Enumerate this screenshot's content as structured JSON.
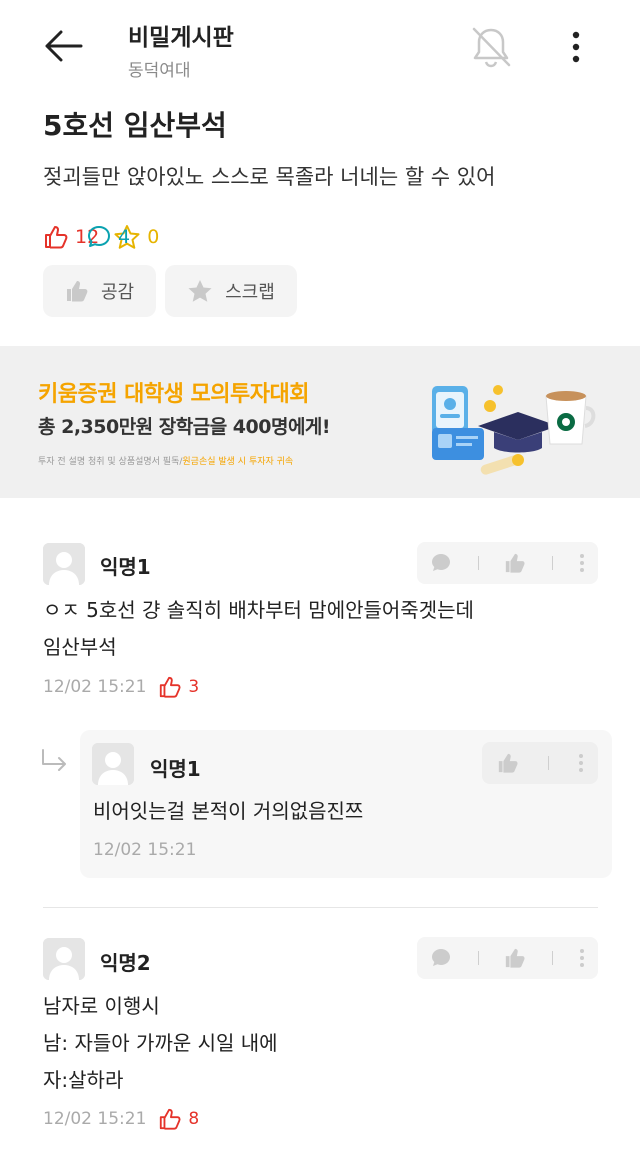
{
  "header": {
    "board_title": "비밀게시판",
    "board_subtitle": "동덕여대",
    "icons": [
      "back-arrow-icon",
      "bell-off-icon",
      "more-vertical-icon"
    ]
  },
  "post": {
    "title": "5호선 임산부석",
    "body": "젖괴들만 앉아있노 스스로 목졸라 너네는 할 수 있어",
    "likes": "12",
    "comments": "4",
    "scraps": "0",
    "like_button": "공감",
    "scrap_button": "스크랩"
  },
  "ad": {
    "title": "키움증권 대학생 모의투자대회",
    "subtitle": "총 2,350만원 장학금을 400명에게!",
    "disclaimer_a": "투자 전 설명 청취 및 상품설명서 필독/",
    "disclaimer_b": "원금손실 발생 시 투자자 귀속"
  },
  "comments": [
    {
      "nick": "익명1",
      "line1": "ㅇㅈ 5호선 걍 솔직히 배차부터 맘에안들어죽겟는데",
      "line2": "임산부석",
      "time": "12/02 15:21",
      "likes": "3",
      "reply": {
        "nick": "익명1",
        "text": "비어잇는걸 본적이 거의없음진쯔",
        "time": "12/02 15:21"
      }
    },
    {
      "nick": "익명2",
      "line1": "남자로 이행시",
      "line2": "남: 자들아 가까운 시일 내에",
      "line3": "자:살하라",
      "time": "12/02 15:21",
      "likes": "8"
    }
  ],
  "colors": {
    "like": "#e5332a",
    "comment": "#0aa2b0",
    "scrap": "#e6b400",
    "ad_accent": "#f5a400"
  }
}
